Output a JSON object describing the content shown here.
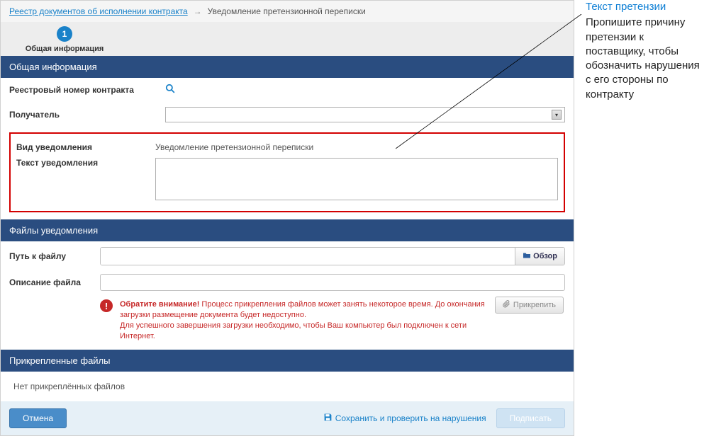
{
  "breadcrumb": {
    "root": "Реестр документов об исполнении контракта",
    "current": "Уведомление претензионной переписки"
  },
  "steps": {
    "s1_num": "1",
    "s1_label": "Общая информация"
  },
  "sections": {
    "general": "Общая информация",
    "files": "Файлы уведомления",
    "attached": "Прикрепленные файлы"
  },
  "form": {
    "registry_no_label": "Реестровый номер контракта",
    "recipient_label": "Получатель",
    "notice_type_label": "Вид уведомления",
    "notice_type_value": "Уведомление претензионной переписки",
    "notice_text_label": "Текст уведомления"
  },
  "fileblock": {
    "path_label": "Путь к файлу",
    "browse": "Обзор",
    "desc_label": "Описание файла",
    "warn_bold": "Обратите внимание!",
    "warn_line1": " Процесс прикрепления файлов может занять некоторое время. До окончания загрузки размещение документа будет недоступно.",
    "warn_line2": "Для успешного завершения загрузки необходимо, чтобы Ваш компьютер был подключен к сети Интернет.",
    "attach": "Прикрепить",
    "empty": "Нет прикреплённых файлов"
  },
  "footer": {
    "cancel": "Отмена",
    "save_check": "Сохранить и проверить на нарушения",
    "sign": "Подписать"
  },
  "annotation": {
    "title": "Текст претензии",
    "body": "Пропишите причину претензии к поставщику, чтобы обозначить нарушения с его стороны по контракту"
  }
}
